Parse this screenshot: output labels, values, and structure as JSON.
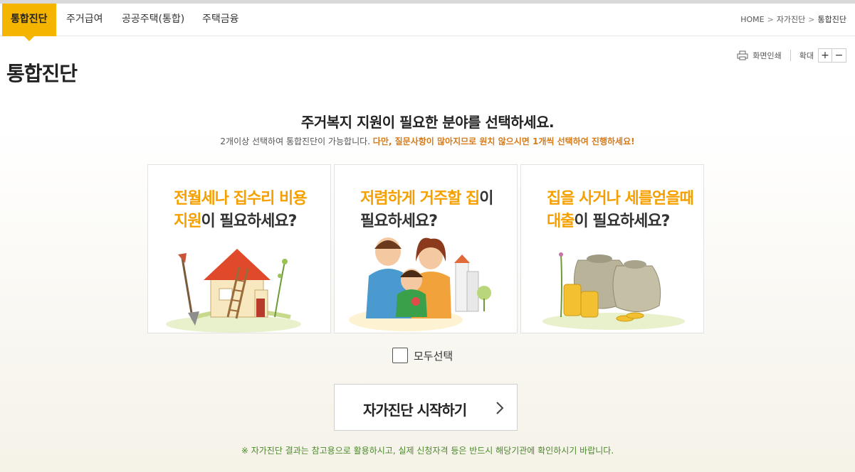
{
  "tabs": [
    {
      "label": "통합진단",
      "active": true
    },
    {
      "label": "주거급여"
    },
    {
      "label": "공공주택(통합)"
    },
    {
      "label": "주택금융"
    }
  ],
  "breadcrumb": {
    "home": "HOME",
    "sep": ">",
    "level1": "자가진단",
    "current": "통합진단"
  },
  "tools": {
    "print": "화면인쇄",
    "zoom": "확대",
    "zoom_in": "+",
    "zoom_out": "−"
  },
  "page_title": "통합진단",
  "heading": "주거복지 지원이 필요한 분야를 선택하세요.",
  "subtext": {
    "normal": "2개이상 선택하여 통합진단이 가능합니다. ",
    "warning": "다만, 질문사항이 많아지므로 원치 않으시면 1개씩 선택하여 진행하세요!"
  },
  "cards": [
    {
      "line1_hl": "전월세나 집수리 비용",
      "line2_hl": "지원",
      "line2_rest": "이 필요하세요?"
    },
    {
      "line1_hl": "저렴하게 거주할 집",
      "line1_rest": "이",
      "line2_rest": "필요하세요?"
    },
    {
      "line1_hl": "집을 사거나 세를얻을때",
      "line2_hl": "대출",
      "line2_rest": "이 필요하세요?"
    }
  ],
  "select_all": "모두선택",
  "start_button": "자가진단 시작하기",
  "note": "※ 자가진단 결과는 참고용으로 활용하시고, 실제 신청자격 등은 반드시 해당기관에 확인하시기 바랍니다.",
  "colors": {
    "accent": "#f5b400",
    "highlight": "#f5a000",
    "warning": "#d67a1a",
    "note": "#4a8a2a"
  }
}
